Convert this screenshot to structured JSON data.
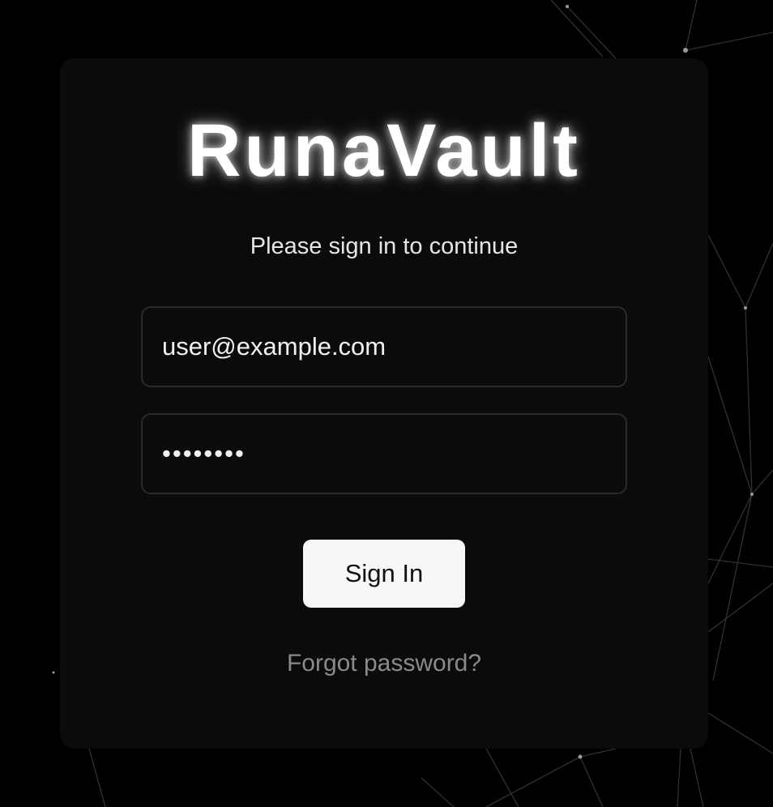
{
  "brand": {
    "title": "RunaVault"
  },
  "login": {
    "subtitle": "Please sign in to continue",
    "email_value": "user@example.com",
    "password_value": "••••••••",
    "signin_label": "Sign In",
    "forgot_label": "Forgot password?"
  },
  "colors": {
    "background": "#000000",
    "card": "#0b0b0c",
    "button": "#f7f7f8",
    "muted_link": "#8a8a8a"
  }
}
